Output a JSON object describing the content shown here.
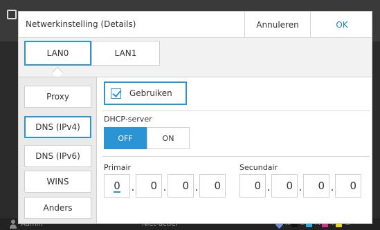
{
  "background": {
    "user": "Admin",
    "status": "Niet-actief",
    "inks": [
      "K",
      "C",
      "M",
      "Y",
      "G"
    ],
    "ink_colors": [
      "#111111",
      "#29a9e1",
      "#d6338c",
      "#e8d51a",
      "#8a8a8a"
    ]
  },
  "dialog": {
    "title": "Netwerkinstelling (Details)",
    "cancel_label": "Annuleren",
    "ok_label": "OK",
    "tabs": [
      {
        "label": "LAN0",
        "selected": true
      },
      {
        "label": "LAN1",
        "selected": false
      }
    ],
    "sidebar": [
      {
        "label": "Proxy",
        "selected": false
      },
      {
        "label": "DNS (IPv4)",
        "selected": true
      },
      {
        "label": "DNS (IPv6)",
        "selected": false
      },
      {
        "label": "WINS",
        "selected": false
      },
      {
        "label": "Anders",
        "selected": false
      }
    ],
    "use_checkbox": {
      "label": "Gebruiken",
      "checked": true
    },
    "dhcp": {
      "label": "DHCP-server",
      "options": [
        "OFF",
        "ON"
      ],
      "selected": "OFF"
    },
    "primary": {
      "label": "Primair",
      "octets": [
        "0",
        "0",
        "0",
        "0"
      ]
    },
    "secondary": {
      "label": "Secundair",
      "octets": [
        "0",
        "0",
        "0",
        "0"
      ]
    }
  },
  "colors": {
    "accent": "#2b95d4",
    "ok_text": "#1a7fc2"
  }
}
